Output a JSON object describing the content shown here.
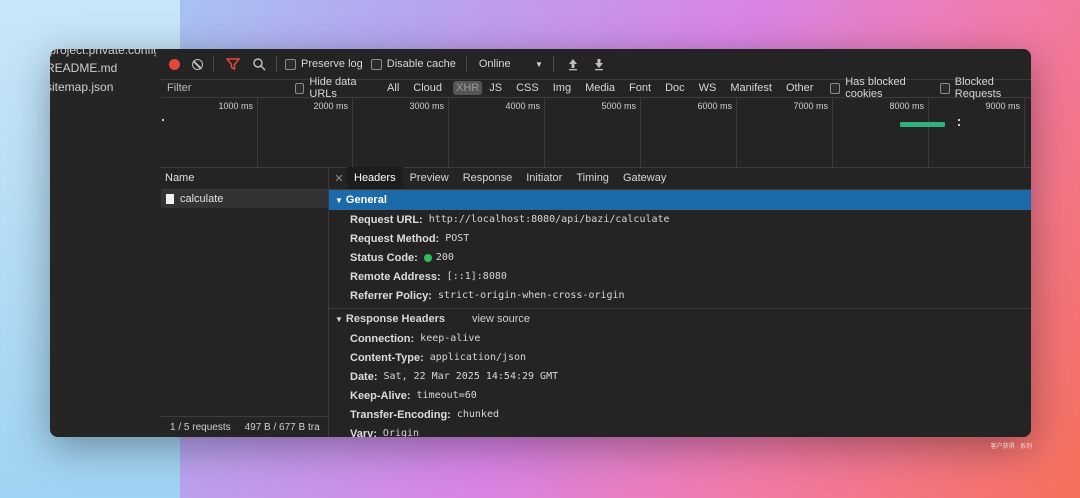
{
  "files": [
    ".project.private.config...",
    "README.md",
    "sitemap.json"
  ],
  "toolbar": {
    "preserve_log": "Preserve log",
    "disable_cache": "Disable cache",
    "throttle": "Online"
  },
  "filterbar": {
    "placeholder": "Filter",
    "hide_data_urls": "Hide data URLs",
    "types": [
      "All",
      "Cloud",
      "XHR",
      "JS",
      "CSS",
      "Img",
      "Media",
      "Font",
      "Doc",
      "WS",
      "Manifest",
      "Other"
    ],
    "active_type": "XHR",
    "has_blocked_cookies": "Has blocked cookies",
    "blocked_requests": "Blocked Requests"
  },
  "timeline": {
    "ticks": [
      "1000 ms",
      "2000 ms",
      "3000 ms",
      "4000 ms",
      "5000 ms",
      "6000 ms",
      "7000 ms",
      "8000 ms",
      "9000 ms"
    ]
  },
  "requests": {
    "column": "Name",
    "items": [
      {
        "name": "calculate"
      }
    ],
    "summary": "1 / 5 requests",
    "transfer": "497 B / 677 B tra"
  },
  "detail": {
    "tabs": [
      "Headers",
      "Preview",
      "Response",
      "Initiator",
      "Timing",
      "Gateway"
    ],
    "active_tab": "Headers",
    "general": {
      "title": "General",
      "rows": [
        {
          "key": "Request URL:",
          "value": "http://localhost:8080/api/bazi/calculate"
        },
        {
          "key": "Request Method:",
          "value": "POST"
        },
        {
          "key": "Status Code:",
          "value": "200"
        },
        {
          "key": "Remote Address:",
          "value": "[::1]:8080"
        },
        {
          "key": "Referrer Policy:",
          "value": "strict-origin-when-cross-origin"
        }
      ]
    },
    "response_headers": {
      "title": "Response Headers",
      "view_source": "view source",
      "rows": [
        {
          "key": "Connection:",
          "value": "keep-alive"
        },
        {
          "key": "Content-Type:",
          "value": "application/json"
        },
        {
          "key": "Date:",
          "value": "Sat, 22 Mar 2025 14:54:29 GMT"
        },
        {
          "key": "Keep-Alive:",
          "value": "timeout=60"
        },
        {
          "key": "Transfer-Encoding:",
          "value": "chunked"
        },
        {
          "key": "Vary:",
          "value": "Origin"
        }
      ]
    }
  },
  "colors": {
    "record": "#e5483b",
    "filter_icon": "#e5483b",
    "selected_section": "#1c6aa8",
    "status_ok": "#2fbf57",
    "waterfall": "#2fb17f"
  },
  "watermark": "客户获得 · 系列"
}
